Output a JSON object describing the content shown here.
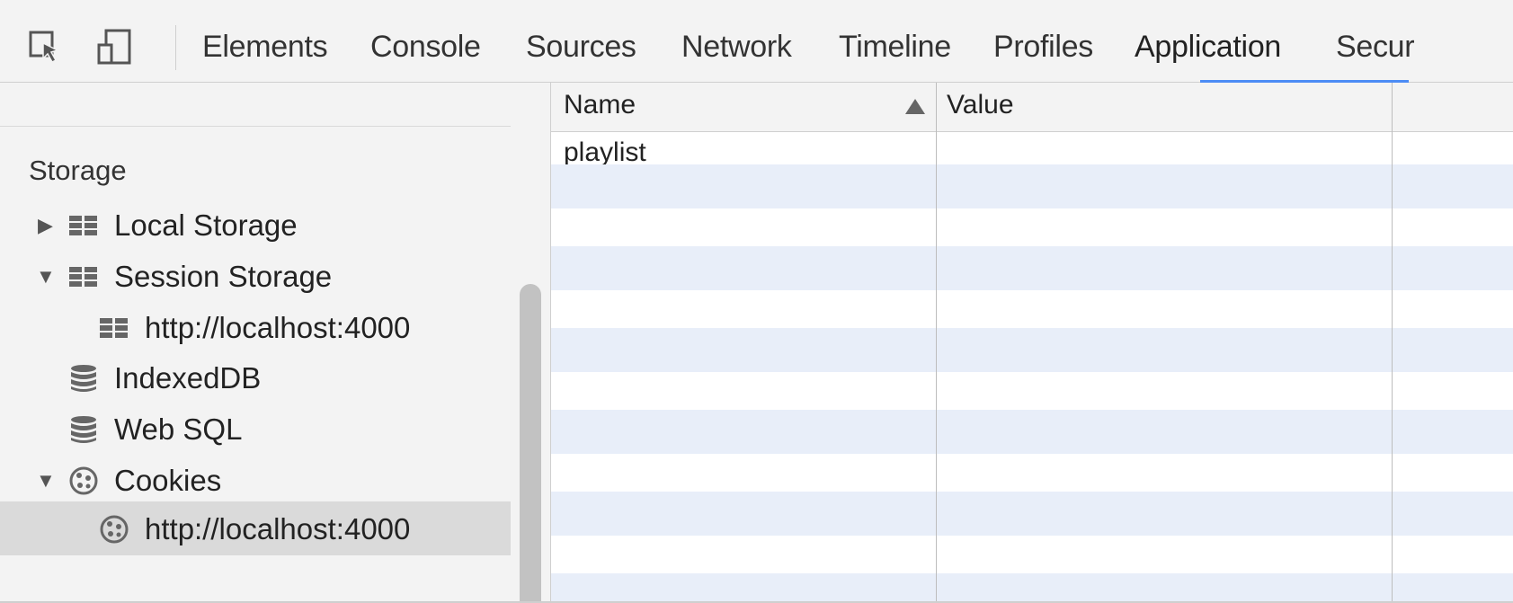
{
  "toolbar": {
    "tabs": [
      "Elements",
      "Console",
      "Sources",
      "Network",
      "Timeline",
      "Profiles",
      "Application",
      "Secur"
    ],
    "active_tab": "Application"
  },
  "sidebar": {
    "section_title": "Storage",
    "items": [
      {
        "label": "Local Storage",
        "icon": "grid-icon",
        "expanded": false
      },
      {
        "label": "Session Storage",
        "icon": "grid-icon",
        "expanded": true
      },
      {
        "label": "http://localhost:4000",
        "icon": "grid-icon"
      },
      {
        "label": "IndexedDB",
        "icon": "database-icon"
      },
      {
        "label": "Web SQL",
        "icon": "database-icon"
      },
      {
        "label": "Cookies",
        "icon": "cookie-icon",
        "expanded": true
      },
      {
        "label": "http://localhost:4000",
        "icon": "cookie-icon",
        "selected": true
      }
    ]
  },
  "table": {
    "columns": [
      "Name",
      "Value"
    ],
    "rows": [
      {
        "name": "playlist",
        "value": ""
      }
    ]
  },
  "colors": {
    "accent": "#4c8cf5",
    "row_alt": "#e8eef9",
    "selected": "#dadada"
  }
}
